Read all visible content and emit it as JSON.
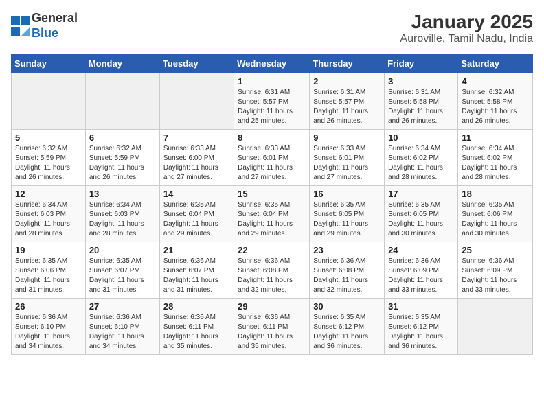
{
  "header": {
    "logo_general": "General",
    "logo_blue": "Blue",
    "title": "January 2025",
    "subtitle": "Auroville, Tamil Nadu, India"
  },
  "weekdays": [
    "Sunday",
    "Monday",
    "Tuesday",
    "Wednesday",
    "Thursday",
    "Friday",
    "Saturday"
  ],
  "weeks": [
    [
      {
        "day": "",
        "info": ""
      },
      {
        "day": "",
        "info": ""
      },
      {
        "day": "",
        "info": ""
      },
      {
        "day": "1",
        "info": "Sunrise: 6:31 AM\nSunset: 5:57 PM\nDaylight: 11 hours and 25 minutes."
      },
      {
        "day": "2",
        "info": "Sunrise: 6:31 AM\nSunset: 5:57 PM\nDaylight: 11 hours and 26 minutes."
      },
      {
        "day": "3",
        "info": "Sunrise: 6:31 AM\nSunset: 5:58 PM\nDaylight: 11 hours and 26 minutes."
      },
      {
        "day": "4",
        "info": "Sunrise: 6:32 AM\nSunset: 5:58 PM\nDaylight: 11 hours and 26 minutes."
      }
    ],
    [
      {
        "day": "5",
        "info": "Sunrise: 6:32 AM\nSunset: 5:59 PM\nDaylight: 11 hours and 26 minutes."
      },
      {
        "day": "6",
        "info": "Sunrise: 6:32 AM\nSunset: 5:59 PM\nDaylight: 11 hours and 26 minutes."
      },
      {
        "day": "7",
        "info": "Sunrise: 6:33 AM\nSunset: 6:00 PM\nDaylight: 11 hours and 27 minutes."
      },
      {
        "day": "8",
        "info": "Sunrise: 6:33 AM\nSunset: 6:01 PM\nDaylight: 11 hours and 27 minutes."
      },
      {
        "day": "9",
        "info": "Sunrise: 6:33 AM\nSunset: 6:01 PM\nDaylight: 11 hours and 27 minutes."
      },
      {
        "day": "10",
        "info": "Sunrise: 6:34 AM\nSunset: 6:02 PM\nDaylight: 11 hours and 28 minutes."
      },
      {
        "day": "11",
        "info": "Sunrise: 6:34 AM\nSunset: 6:02 PM\nDaylight: 11 hours and 28 minutes."
      }
    ],
    [
      {
        "day": "12",
        "info": "Sunrise: 6:34 AM\nSunset: 6:03 PM\nDaylight: 11 hours and 28 minutes."
      },
      {
        "day": "13",
        "info": "Sunrise: 6:34 AM\nSunset: 6:03 PM\nDaylight: 11 hours and 28 minutes."
      },
      {
        "day": "14",
        "info": "Sunrise: 6:35 AM\nSunset: 6:04 PM\nDaylight: 11 hours and 29 minutes."
      },
      {
        "day": "15",
        "info": "Sunrise: 6:35 AM\nSunset: 6:04 PM\nDaylight: 11 hours and 29 minutes."
      },
      {
        "day": "16",
        "info": "Sunrise: 6:35 AM\nSunset: 6:05 PM\nDaylight: 11 hours and 29 minutes."
      },
      {
        "day": "17",
        "info": "Sunrise: 6:35 AM\nSunset: 6:05 PM\nDaylight: 11 hours and 30 minutes."
      },
      {
        "day": "18",
        "info": "Sunrise: 6:35 AM\nSunset: 6:06 PM\nDaylight: 11 hours and 30 minutes."
      }
    ],
    [
      {
        "day": "19",
        "info": "Sunrise: 6:35 AM\nSunset: 6:06 PM\nDaylight: 11 hours and 31 minutes."
      },
      {
        "day": "20",
        "info": "Sunrise: 6:35 AM\nSunset: 6:07 PM\nDaylight: 11 hours and 31 minutes."
      },
      {
        "day": "21",
        "info": "Sunrise: 6:36 AM\nSunset: 6:07 PM\nDaylight: 11 hours and 31 minutes."
      },
      {
        "day": "22",
        "info": "Sunrise: 6:36 AM\nSunset: 6:08 PM\nDaylight: 11 hours and 32 minutes."
      },
      {
        "day": "23",
        "info": "Sunrise: 6:36 AM\nSunset: 6:08 PM\nDaylight: 11 hours and 32 minutes."
      },
      {
        "day": "24",
        "info": "Sunrise: 6:36 AM\nSunset: 6:09 PM\nDaylight: 11 hours and 33 minutes."
      },
      {
        "day": "25",
        "info": "Sunrise: 6:36 AM\nSunset: 6:09 PM\nDaylight: 11 hours and 33 minutes."
      }
    ],
    [
      {
        "day": "26",
        "info": "Sunrise: 6:36 AM\nSunset: 6:10 PM\nDaylight: 11 hours and 34 minutes."
      },
      {
        "day": "27",
        "info": "Sunrise: 6:36 AM\nSunset: 6:10 PM\nDaylight: 11 hours and 34 minutes."
      },
      {
        "day": "28",
        "info": "Sunrise: 6:36 AM\nSunset: 6:11 PM\nDaylight: 11 hours and 35 minutes."
      },
      {
        "day": "29",
        "info": "Sunrise: 6:36 AM\nSunset: 6:11 PM\nDaylight: 11 hours and 35 minutes."
      },
      {
        "day": "30",
        "info": "Sunrise: 6:35 AM\nSunset: 6:12 PM\nDaylight: 11 hours and 36 minutes."
      },
      {
        "day": "31",
        "info": "Sunrise: 6:35 AM\nSunset: 6:12 PM\nDaylight: 11 hours and 36 minutes."
      },
      {
        "day": "",
        "info": ""
      }
    ]
  ]
}
